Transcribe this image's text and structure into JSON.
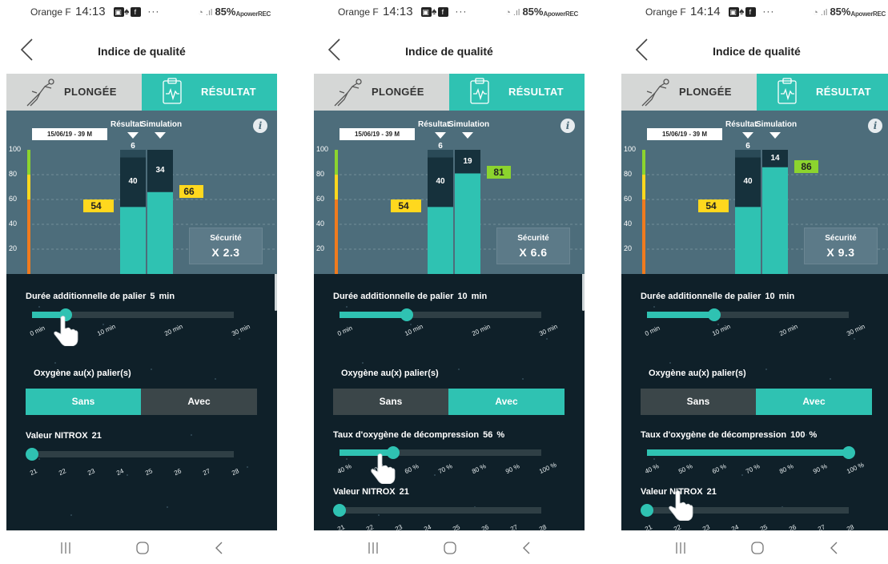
{
  "screens": [
    {
      "status": {
        "carrier": "Orange F",
        "time": "14:13",
        "dots": "···",
        "battery": "85%",
        "watermark": "ApowerREC"
      },
      "header": {
        "title": "Indice de qualité"
      },
      "tabs": {
        "plongee": "PLONGÉE",
        "resultat": "RÉSULTAT"
      },
      "chart": {
        "date": "15/06/19 - 39 M",
        "result_label": "Résultat",
        "simulation_label": "Simulation",
        "result_top": "6",
        "result_mid": "40",
        "sim_top": "34",
        "flag_result": "54",
        "flag_sim": "66",
        "security_title": "Sécurité",
        "security_value": "X 2.3"
      },
      "controls": {
        "palier_label": "Durée additionnelle de palier",
        "palier_value": "5",
        "palier_unit": "min",
        "palier_ticks": [
          "0 min",
          "10 min",
          "20 min",
          "30 min"
        ],
        "oxygen_label": "Oxygène au(x) palier(s)",
        "toggle_sans": "Sans",
        "toggle_avec": "Avec",
        "nitrox_label": "Valeur NITROX",
        "nitrox_value": "21",
        "nitrox_ticks": [
          "21",
          "22",
          "23",
          "24",
          "25",
          "26",
          "27",
          "28"
        ]
      }
    },
    {
      "status": {
        "carrier": "Orange F",
        "time": "14:13",
        "dots": "···",
        "battery": "85%",
        "watermark": "ApowerREC"
      },
      "header": {
        "title": "Indice de qualité"
      },
      "tabs": {
        "plongee": "PLONGÉE",
        "resultat": "RÉSULTAT"
      },
      "chart": {
        "date": "15/06/19 - 39 M",
        "result_label": "Résultat",
        "simulation_label": "Simulation",
        "result_top": "6",
        "result_mid": "40",
        "sim_top": "19",
        "flag_result": "54",
        "flag_sim": "81",
        "security_title": "Sécurité",
        "security_value": "X 6.6"
      },
      "controls": {
        "palier_label": "Durée additionnelle de palier",
        "palier_value": "10",
        "palier_unit": "min",
        "palier_ticks": [
          "0 min",
          "10 min",
          "20 min",
          "30 min"
        ],
        "oxygen_label": "Oxygène au(x) palier(s)",
        "toggle_sans": "Sans",
        "toggle_avec": "Avec",
        "taux_label": "Taux d'oxygène de décompression",
        "taux_value": "56",
        "taux_unit": "%",
        "taux_ticks": [
          "40 %",
          "50 %",
          "60 %",
          "70 %",
          "80 %",
          "90 %",
          "100 %"
        ],
        "nitrox_label": "Valeur NITROX",
        "nitrox_value": "21",
        "nitrox_ticks": [
          "21",
          "22",
          "23",
          "24",
          "25",
          "26",
          "27",
          "28"
        ]
      }
    },
    {
      "status": {
        "carrier": "Orange F",
        "time": "14:14",
        "dots": "···",
        "battery": "85%",
        "watermark": "ApowerREC"
      },
      "header": {
        "title": "Indice de qualité"
      },
      "tabs": {
        "plongee": "PLONGÉE",
        "resultat": "RÉSULTAT"
      },
      "chart": {
        "date": "15/06/19 - 39 M",
        "result_label": "Résultat",
        "simulation_label": "Simulation",
        "result_top": "6",
        "result_mid": "40",
        "sim_top": "14",
        "flag_result": "54",
        "flag_sim": "86",
        "security_title": "Sécurité",
        "security_value": "X 9.3"
      },
      "controls": {
        "palier_label": "Durée additionnelle de palier",
        "palier_value": "10",
        "palier_unit": "min",
        "palier_ticks": [
          "0 min",
          "10 min",
          "20 min",
          "30 min"
        ],
        "oxygen_label": "Oxygène au(x) palier(s)",
        "toggle_sans": "Sans",
        "toggle_avec": "Avec",
        "taux_label": "Taux d'oxygène de décompression",
        "taux_value": "100",
        "taux_unit": "%",
        "taux_ticks": [
          "40 %",
          "50 %",
          "60 %",
          "70 %",
          "80 %",
          "90 %",
          "100 %"
        ],
        "nitrox_label": "Valeur NITROX",
        "nitrox_value": "21",
        "nitrox_ticks": [
          "21",
          "22",
          "23",
          "24",
          "25",
          "26",
          "27",
          "28"
        ]
      }
    }
  ],
  "chart_data": [
    {
      "type": "bar",
      "categories": [
        "Résultat",
        "Simulation"
      ],
      "series": [
        {
          "values": [
            54,
            66
          ]
        },
        {
          "values": [
            40,
            34
          ]
        },
        {
          "values": [
            6,
            0
          ]
        }
      ],
      "y_ticks": [
        20,
        40,
        60,
        80,
        100
      ],
      "ylim": [
        0,
        100
      ]
    },
    {
      "type": "bar",
      "categories": [
        "Résultat",
        "Simulation"
      ],
      "series": [
        {
          "values": [
            54,
            81
          ]
        },
        {
          "values": [
            40,
            19
          ]
        },
        {
          "values": [
            6,
            0
          ]
        }
      ],
      "y_ticks": [
        20,
        40,
        60,
        80,
        100
      ],
      "ylim": [
        0,
        100
      ]
    },
    {
      "type": "bar",
      "categories": [
        "Résultat",
        "Simulation"
      ],
      "series": [
        {
          "values": [
            54,
            86
          ]
        },
        {
          "values": [
            40,
            14
          ]
        },
        {
          "values": [
            6,
            0
          ]
        }
      ],
      "y_ticks": [
        20,
        40,
        60,
        80,
        100
      ],
      "ylim": [
        0,
        100
      ]
    }
  ],
  "slider_levels": [
    {
      "palier": 0.167,
      "oxygen": "Sans",
      "taux": null,
      "nitrox": 0.0
    },
    {
      "palier": 0.333,
      "oxygen": "Avec",
      "taux": 0.267,
      "nitrox": 0.0
    },
    {
      "palier": 0.333,
      "oxygen": "Avec",
      "taux": 1.0,
      "nitrox": 0.0
    }
  ],
  "colors": {
    "teal": "#2fc2b2",
    "chart_bg": "#4d6d7b",
    "dark_bg": "#0f2029",
    "flag_yellow": "#ffd81e",
    "flag_green": "#8cd42e",
    "gauge_green": "#8cd42e",
    "gauge_yellow": "#ffd81e",
    "gauge_orange": "#f07b1e"
  },
  "icons": {
    "back": "chevron-left-icon",
    "plongee": "diver-icon",
    "resultat": "clipboard-pulse-icon",
    "info": "info-icon",
    "nav_recent": "recent-apps-icon",
    "nav_home": "home-icon",
    "nav_back": "nav-back-icon",
    "hand": "tap-hand-icon"
  }
}
